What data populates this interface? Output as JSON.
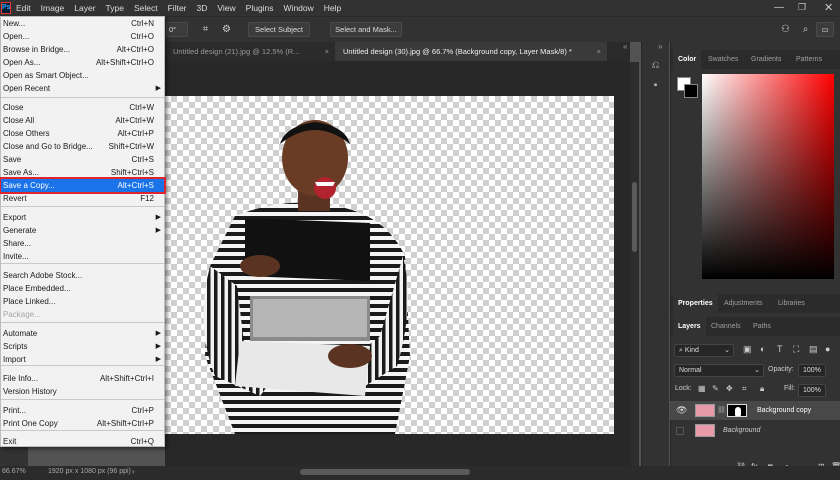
{
  "menubar": {
    "logo": "Ps",
    "items": [
      "Edit",
      "Image",
      "Layer",
      "Type",
      "Select",
      "Filter",
      "3D",
      "View",
      "Plugins",
      "Window",
      "Help"
    ]
  },
  "options": {
    "angle_value": "0°",
    "select_subject": "Select Subject",
    "select_and_mask": "Select and Mask..."
  },
  "tabs": [
    {
      "label": "Untitled design (21).jpg @ 12.5% (R...",
      "close": "×"
    },
    {
      "label": "Untitled design (30).jpg @ 66.7% (Background copy, Layer Mask/8) *",
      "close": "×"
    }
  ],
  "status": {
    "zoom": "66.67%",
    "doc_info": "1920 px x 1080 px (96 ppi)"
  },
  "color_panel": {
    "tabs": [
      "Color",
      "Swatches",
      "Gradients",
      "Patterns"
    ],
    "fg_color": "#ffffff",
    "bg_color": "#000000"
  },
  "props_panel": {
    "tabs": [
      "Properties",
      "Adjustments",
      "Libraries"
    ]
  },
  "layers_panel": {
    "tabs": [
      "Layers",
      "Channels",
      "Paths"
    ],
    "kind_label": "Kind",
    "blend_mode": "Normal",
    "opacity_label": "Opacity:",
    "opacity_value": "100%",
    "lock_label": "Lock:",
    "fill_label": "Fill:",
    "fill_value": "100%",
    "layers": [
      {
        "name": "Background copy",
        "selected": true
      },
      {
        "name": "Background",
        "selected": false
      }
    ],
    "footer_icons": [
      "link-icon",
      "fx-icon",
      "mask-icon",
      "adjustment-icon",
      "group-icon",
      "new-layer-icon",
      "trash-icon"
    ]
  },
  "file_menu": {
    "items": [
      {
        "label": "New...",
        "shortcut": "Ctrl+N"
      },
      {
        "label": "Open...",
        "shortcut": "Ctrl+O"
      },
      {
        "label": "Browse in Bridge...",
        "shortcut": "Alt+Ctrl+O"
      },
      {
        "label": "Open As...",
        "shortcut": "Alt+Shift+Ctrl+O"
      },
      {
        "label": "Open as Smart Object..."
      },
      {
        "label": "Open Recent",
        "submenu": true
      },
      {
        "label": "Close",
        "shortcut": "Ctrl+W"
      },
      {
        "label": "Close All",
        "shortcut": "Alt+Ctrl+W"
      },
      {
        "label": "Close Others",
        "shortcut": "Alt+Ctrl+P"
      },
      {
        "label": "Close and Go to Bridge...",
        "shortcut": "Shift+Ctrl+W"
      },
      {
        "label": "Save",
        "shortcut": "Ctrl+S"
      },
      {
        "label": "Save As...",
        "shortcut": "Shift+Ctrl+S"
      },
      {
        "label": "Save a Copy...",
        "shortcut": "Alt+Ctrl+S",
        "highlighted": true
      },
      {
        "label": "Revert",
        "shortcut": "F12"
      },
      {
        "label": "Export",
        "submenu": true
      },
      {
        "label": "Generate",
        "submenu": true
      },
      {
        "label": "Share..."
      },
      {
        "label": "Invite..."
      },
      {
        "label": "Search Adobe Stock..."
      },
      {
        "label": "Place Embedded..."
      },
      {
        "label": "Place Linked..."
      },
      {
        "label": "Package...",
        "disabled": true
      },
      {
        "label": "Automate",
        "submenu": true
      },
      {
        "label": "Scripts",
        "submenu": true
      },
      {
        "label": "Import",
        "submenu": true
      },
      {
        "label": "File Info...",
        "shortcut": "Alt+Shift+Ctrl+I"
      },
      {
        "label": "Version History"
      },
      {
        "label": "Print...",
        "shortcut": "Ctrl+P"
      },
      {
        "label": "Print One Copy",
        "shortcut": "Alt+Shift+Ctrl+P"
      },
      {
        "label": "Exit",
        "shortcut": "Ctrl+Q"
      }
    ]
  }
}
